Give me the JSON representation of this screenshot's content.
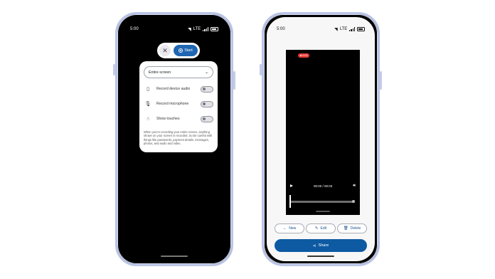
{
  "left_phone": {
    "status": {
      "time": "5:00",
      "network": "LTE"
    },
    "pill": {
      "close_icon": "close-icon",
      "start_label": "Start"
    },
    "card": {
      "dropdown_value": "Entire screen",
      "options": [
        {
          "icon": "phone-icon",
          "label": "Record device audio",
          "enabled": false
        },
        {
          "icon": "microphone-icon",
          "label": "Record microphone",
          "enabled": false
        },
        {
          "icon": "touch-icon",
          "label": "Show touches",
          "enabled": false
        }
      ],
      "note": "When you’re recording your entire screen, anything shown on your screen is recorded. So be careful with things like passwords, payment details, messages, photos, and audio and video."
    }
  },
  "right_phone": {
    "status": {
      "time": "5:00",
      "network": "LTE"
    },
    "video": {
      "rec_badge": "0:03",
      "time_label": "00:00 / 00:03"
    },
    "actions": [
      {
        "icon": "arrow-left-icon",
        "label": "New"
      },
      {
        "icon": "edit-icon",
        "label": "Edit"
      },
      {
        "icon": "delete-icon",
        "label": "Delete"
      }
    ],
    "share_label": "Share"
  },
  "colors": {
    "accent": "#0d5aa3",
    "frame": "#b9c4e6",
    "rec": "#e53935"
  }
}
